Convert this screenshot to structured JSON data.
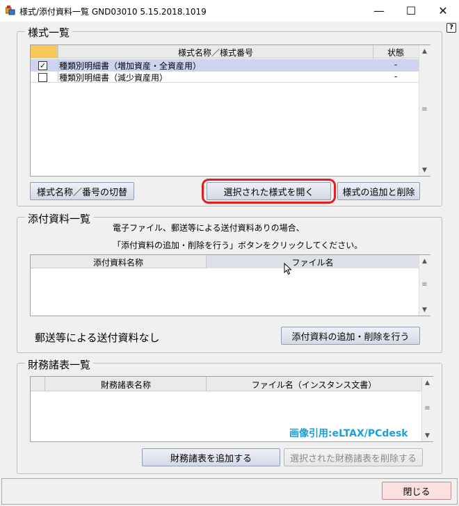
{
  "window": {
    "title": "様式/添付資料一覧 GND03010  5.15.2018.1019",
    "minimize": "—",
    "maximize": "☐",
    "close": "✕",
    "help": "?"
  },
  "forms_group": {
    "title": "様式一覧",
    "columns": [
      "様式名称／様式番号",
      "状態"
    ],
    "rows": [
      {
        "name": "種類別明細書（増加資産・全資産用）",
        "status": "-",
        "checked": true,
        "selected": true
      },
      {
        "name": "種類別明細書（減少資産用）",
        "status": "-",
        "checked": false,
        "selected": false
      }
    ],
    "check_mark": "✓",
    "btn_switch": "様式名称／番号の切替",
    "btn_open": "選択された様式を開く",
    "btn_add_delete": "様式の追加と削除"
  },
  "attach_group": {
    "title": "添付資料一覧",
    "note_line1": "電子ファイル、郵送等による送付資料ありの場合、",
    "note_line2": "「添付資料の追加・削除を行う」ボタンをクリックしてください。",
    "columns": [
      "添付資料名称",
      "ファイル名"
    ],
    "status_text": "郵送等による送付資料なし",
    "btn_add_delete": "添付資料の追加・削除を行う"
  },
  "fin_group": {
    "title": "財務諸表一覧",
    "columns": [
      "財務諸表名称",
      "ファイル名（インスタンス文書）"
    ],
    "watermark": "画像引用:eLTAX/PCdesk",
    "btn_add": "財務諸表を追加する",
    "btn_delete": "選択された財務諸表を削除する"
  },
  "footer": {
    "btn_close": "閉じる"
  },
  "scroll": {
    "up": "▲",
    "down": "▼",
    "thumb": "≡"
  },
  "colors": {
    "highlight_outline": "#e02020",
    "selected_row": "#cfd3f2",
    "close_button": "#fbe0e0",
    "watermark": "#1a9fd8",
    "checkbox_header": "#f7c75a"
  }
}
